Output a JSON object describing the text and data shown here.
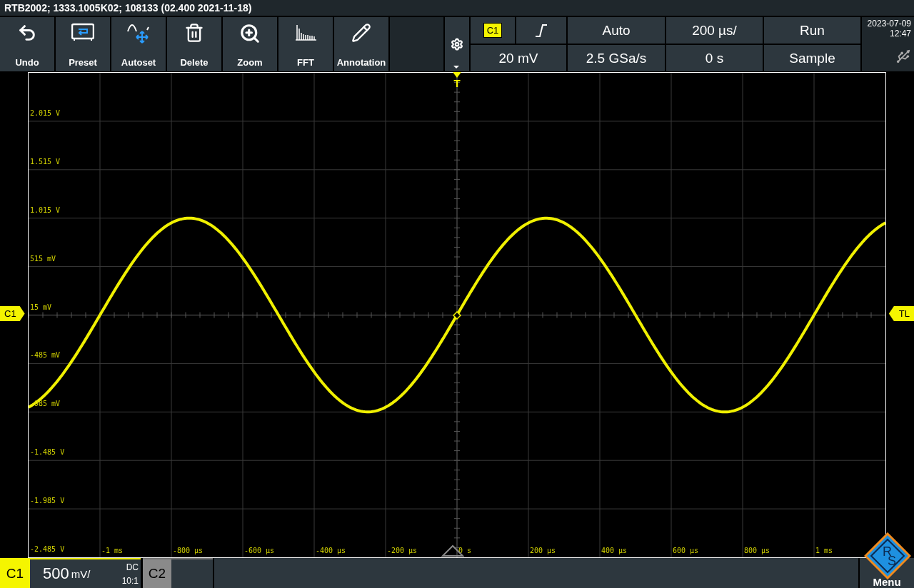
{
  "title_bar": "RTB2002; 1333.1005K02; 108133 (02.400 2021-11-18)",
  "toolbar": [
    {
      "label": "Undo",
      "kind": "undo"
    },
    {
      "label": "Preset",
      "kind": "preset"
    },
    {
      "label": "Autoset",
      "kind": "autoset"
    },
    {
      "label": "Delete",
      "kind": "delete"
    },
    {
      "label": "Zoom",
      "kind": "zoom"
    },
    {
      "label": "FFT",
      "kind": "fft"
    },
    {
      "label": "Annotation",
      "kind": "annotation"
    }
  ],
  "trigger": {
    "channel": "C1",
    "mode": "Auto",
    "trigger_level": "20 mV"
  },
  "horizontal": {
    "timebase": "200 µs/",
    "sample_rate": "2.5 GSa/s",
    "position": "0 s"
  },
  "acquisition": {
    "run_state": "Run",
    "mode": "Sample"
  },
  "clock": {
    "date": "2023-07-09",
    "time": "12:47"
  },
  "plot": {
    "y_labels": [
      "2.015 V",
      "1.515 V",
      "1.015 V",
      "515 mV",
      "15 mV",
      "-485 mV",
      "-985 mV",
      "-1.485 V",
      "-1.985 V",
      "-2.485 V"
    ],
    "x_labels": [
      "-1 ms",
      "-800 µs",
      "-600 µs",
      "-400 µs",
      "-200 µs",
      "0 s",
      "200 µs",
      "400 µs",
      "600 µs",
      "800 µs",
      "1 ms"
    ],
    "channel_marker": "C1",
    "trigger_level_marker": "TL",
    "trigger_marker": "T"
  },
  "channels": [
    {
      "name": "C1",
      "active": true,
      "scale": "500",
      "unit": "mV/",
      "coupling": "DC",
      "probe": "10:1"
    },
    {
      "name": "C2",
      "active": false
    }
  ],
  "menu": {
    "logo_letters": [
      "R",
      "S"
    ],
    "label": "Menu"
  }
}
